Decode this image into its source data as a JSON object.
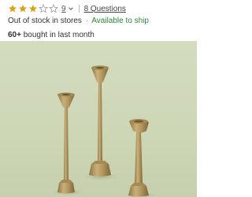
{
  "rating": {
    "stars_filled": 3,
    "stars_total": 5,
    "review_count": "9",
    "questions_label": "8 Questions",
    "star_color": "#d9a21b"
  },
  "availability": {
    "store_status": "Out of stock in stores",
    "separator": "·",
    "ship_status": "Available to ship",
    "ship_color": "#2e8540"
  },
  "social_proof": {
    "count": "60+",
    "text": "bought in last month"
  },
  "product_image": {
    "subject": "three brass taper candlesticks",
    "background_color": "#cfd8b8",
    "metal_color": "#b39a62"
  }
}
